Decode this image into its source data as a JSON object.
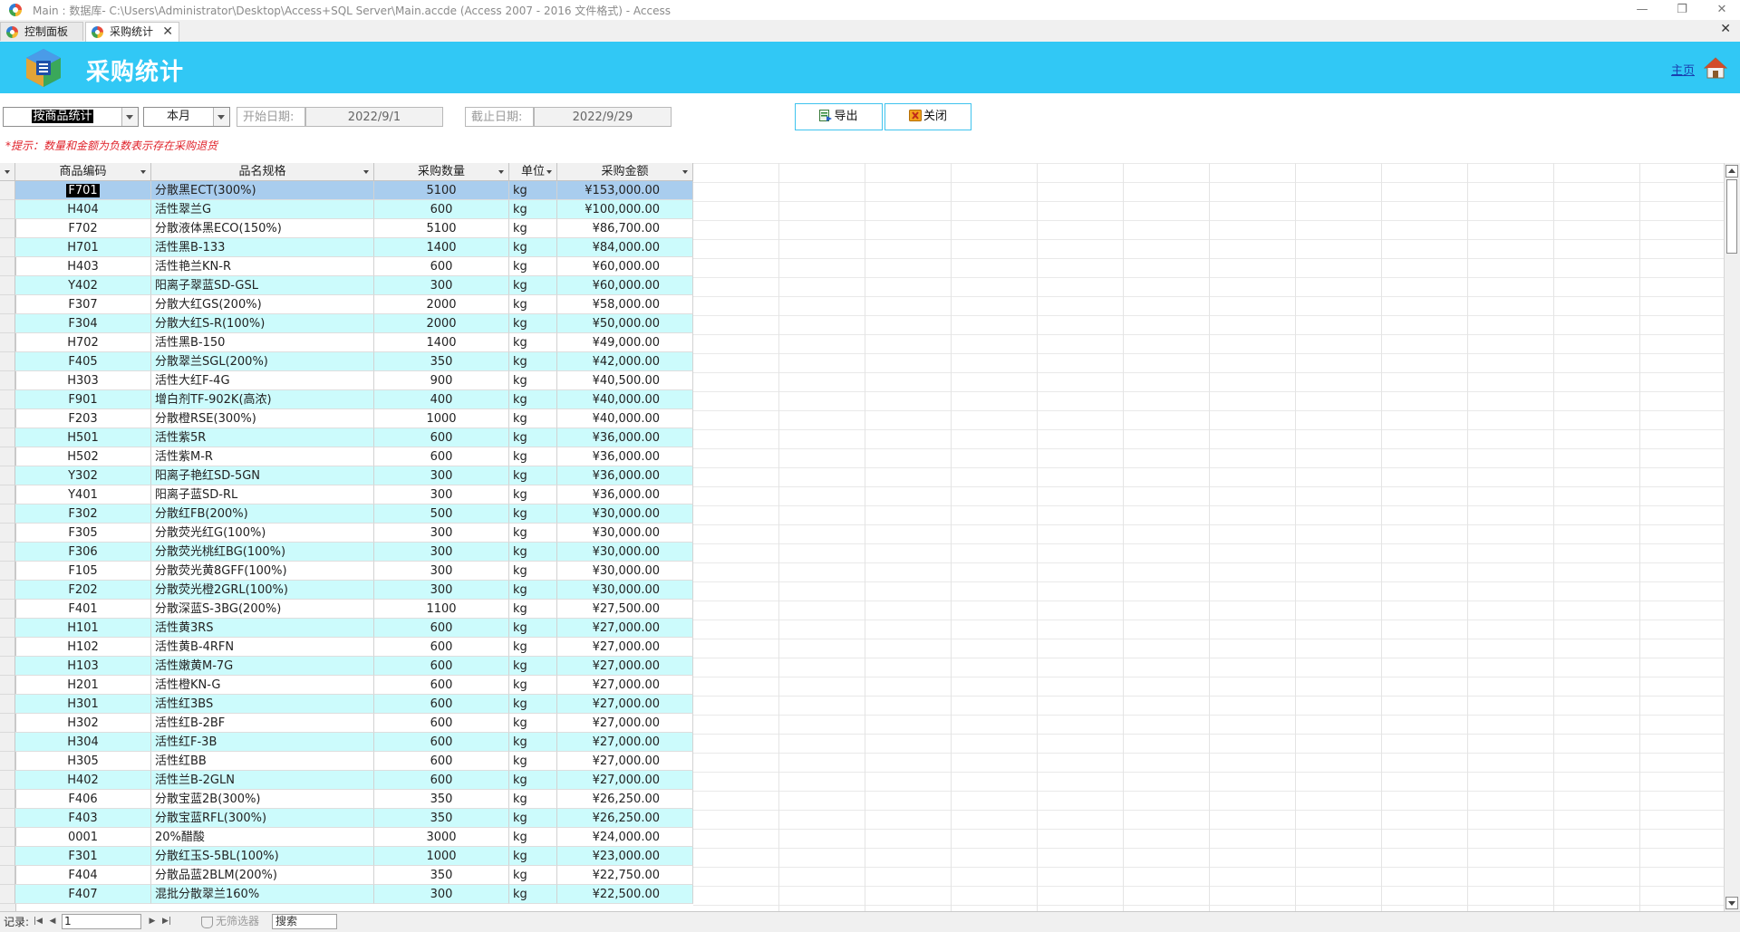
{
  "window": {
    "title": "Main : 数据库- C:\\Users\\Administrator\\Desktop\\Access+SQL Server\\Main.accde (Access 2007 - 2016 文件格式) - Access",
    "minimize": "—",
    "restore": "❐",
    "close": "✕"
  },
  "tabs": [
    {
      "label": "控制面板"
    },
    {
      "label": "采购统计",
      "close": "✕"
    }
  ],
  "tabstrip_close": "✕",
  "header": {
    "title": "采购统计",
    "home_link": "主页",
    "colors": {
      "banner": "#31c8f5",
      "title_text": "#ffffff"
    }
  },
  "filters": {
    "mode": "按商品统计",
    "period": "本月",
    "start_label": "开始日期:",
    "start_date": "2022/9/1",
    "end_label": "截止日期:",
    "end_date": "2022/9/29"
  },
  "buttons": {
    "export": "导出",
    "close": "关闭"
  },
  "hint": "*提示：数量和金额为负数表示存在采购退货",
  "table": {
    "columns": [
      "商品编码",
      "品名规格",
      "采购数量",
      "单位",
      "采购金额"
    ],
    "rows": [
      [
        "F701",
        "分散黑ECT(300%)",
        "5100",
        "kg",
        "¥153,000.00"
      ],
      [
        "H404",
        "活性翠兰G",
        "600",
        "kg",
        "¥100,000.00"
      ],
      [
        "F702",
        "分散液体黑ECO(150%)",
        "5100",
        "kg",
        "¥86,700.00"
      ],
      [
        "H701",
        "活性黑B-133",
        "1400",
        "kg",
        "¥84,000.00"
      ],
      [
        "H403",
        "活性艳兰KN-R",
        "600",
        "kg",
        "¥60,000.00"
      ],
      [
        "Y402",
        "阳离子翠蓝SD-GSL",
        "300",
        "kg",
        "¥60,000.00"
      ],
      [
        "F307",
        "分散大红GS(200%)",
        "2000",
        "kg",
        "¥58,000.00"
      ],
      [
        "F304",
        "分散大红S-R(100%)",
        "2000",
        "kg",
        "¥50,000.00"
      ],
      [
        "H702",
        "活性黑B-150",
        "1400",
        "kg",
        "¥49,000.00"
      ],
      [
        "F405",
        "分散翠兰SGL(200%)",
        "350",
        "kg",
        "¥42,000.00"
      ],
      [
        "H303",
        "活性大红F-4G",
        "900",
        "kg",
        "¥40,500.00"
      ],
      [
        "F901",
        "增白剂TF-902K(高浓)",
        "400",
        "kg",
        "¥40,000.00"
      ],
      [
        "F203",
        "分散橙RSE(300%)",
        "1000",
        "kg",
        "¥40,000.00"
      ],
      [
        "H501",
        "活性紫5R",
        "600",
        "kg",
        "¥36,000.00"
      ],
      [
        "H502",
        "活性紫M-R",
        "600",
        "kg",
        "¥36,000.00"
      ],
      [
        "Y302",
        "阳离子艳红SD-5GN",
        "300",
        "kg",
        "¥36,000.00"
      ],
      [
        "Y401",
        "阳离子蓝SD-RL",
        "300",
        "kg",
        "¥36,000.00"
      ],
      [
        "F302",
        "分散红FB(200%)",
        "500",
        "kg",
        "¥30,000.00"
      ],
      [
        "F305",
        "分散荧光红G(100%)",
        "300",
        "kg",
        "¥30,000.00"
      ],
      [
        "F306",
        "分散荧光桃红BG(100%)",
        "300",
        "kg",
        "¥30,000.00"
      ],
      [
        "F105",
        "分散荧光黄8GFF(100%)",
        "300",
        "kg",
        "¥30,000.00"
      ],
      [
        "F202",
        "分散荧光橙2GRL(100%)",
        "300",
        "kg",
        "¥30,000.00"
      ],
      [
        "F401",
        "分散深蓝S-3BG(200%)",
        "1100",
        "kg",
        "¥27,500.00"
      ],
      [
        "H101",
        "活性黄3RS",
        "600",
        "kg",
        "¥27,000.00"
      ],
      [
        "H102",
        "活性黄B-4RFN",
        "600",
        "kg",
        "¥27,000.00"
      ],
      [
        "H103",
        "活性嫩黄M-7G",
        "600",
        "kg",
        "¥27,000.00"
      ],
      [
        "H201",
        "活性橙KN-G",
        "600",
        "kg",
        "¥27,000.00"
      ],
      [
        "H301",
        "活性红3BS",
        "600",
        "kg",
        "¥27,000.00"
      ],
      [
        "H302",
        "活性红B-2BF",
        "600",
        "kg",
        "¥27,000.00"
      ],
      [
        "H304",
        "活性红F-3B",
        "600",
        "kg",
        "¥27,000.00"
      ],
      [
        "H305",
        "活性红BB",
        "600",
        "kg",
        "¥27,000.00"
      ],
      [
        "H402",
        "活性兰B-2GLN",
        "600",
        "kg",
        "¥27,000.00"
      ],
      [
        "F406",
        "分散宝蓝2B(300%)",
        "350",
        "kg",
        "¥26,250.00"
      ],
      [
        "F403",
        "分散宝蓝RFL(300%)",
        "350",
        "kg",
        "¥26,250.00"
      ],
      [
        "0001",
        "20%醋酸",
        "3000",
        "kg",
        "¥24,000.00"
      ],
      [
        "F301",
        "分散红玉S-5BL(100%)",
        "1000",
        "kg",
        "¥23,000.00"
      ],
      [
        "F404",
        "分散品蓝2BLM(200%)",
        "350",
        "kg",
        "¥22,750.00"
      ],
      [
        "F407",
        "混批分散翠兰160%",
        "300",
        "kg",
        "¥22,500.00"
      ]
    ]
  },
  "navbar": {
    "records_label": "记录:",
    "first": "|◀",
    "prev": "◀",
    "current": "1",
    "next": "▶",
    "last": "▶|",
    "filter": "无筛选器",
    "search": "搜索"
  }
}
